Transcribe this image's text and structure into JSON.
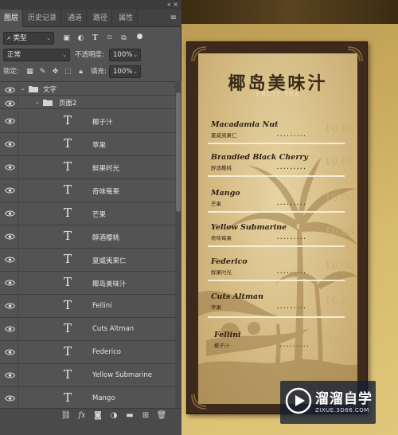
{
  "panel": {
    "tabs": [
      "图层",
      "历史记录",
      "通道",
      "路径",
      "属性"
    ],
    "active_tab": "图层",
    "filter": {
      "kind_label": "类型"
    },
    "blend_mode": "正常",
    "opacity_label": "不透明度:",
    "opacity_value": "100%",
    "lock_label": "锁定:",
    "fill_label": "填充:",
    "fill_value": "100%"
  },
  "layers": {
    "group_text": "文字",
    "group_page": "页面2",
    "text_layers": [
      "椰子汁",
      "苹果",
      "鲜果时光",
      "奇味莓果",
      "芒果",
      "醉酒樱桃",
      "夏威夷果仁",
      "椰岛美味汁",
      "Fellini",
      "Cuts Altman",
      "Federico",
      "Yellow Submarine",
      "Mango"
    ]
  },
  "menu": {
    "title": "椰岛美味汁",
    "subtitle": "FRUIT TEA",
    "items": [
      {
        "en": "Macadamia Nut",
        "cn": "夏威夷果仁",
        "price": "10.00"
      },
      {
        "en": "Brandied Black Cherry",
        "cn": "醉酒樱桃",
        "price": "10.00"
      },
      {
        "en": "Mango",
        "cn": "芒果",
        "price": "10.00"
      },
      {
        "en": "Yellow Submarine",
        "cn": "奇味莓果",
        "price": "10.00"
      },
      {
        "en": "Federico",
        "cn": "鲜果时光",
        "price": "10.00"
      },
      {
        "en": "Cuts Altman",
        "cn": "苹果",
        "price": "10.00"
      },
      {
        "en": "Fellini",
        "cn": "椰子汁",
        "price": "10.00"
      }
    ],
    "dots": "........."
  },
  "watermark": {
    "name": "溜溜自学",
    "url": "ZIXUE.3D66.COM"
  },
  "colors": {
    "panel_bg": "#535353",
    "menu_frame": "#3d2a1c",
    "canvas_gold": "#d7bb6e"
  }
}
